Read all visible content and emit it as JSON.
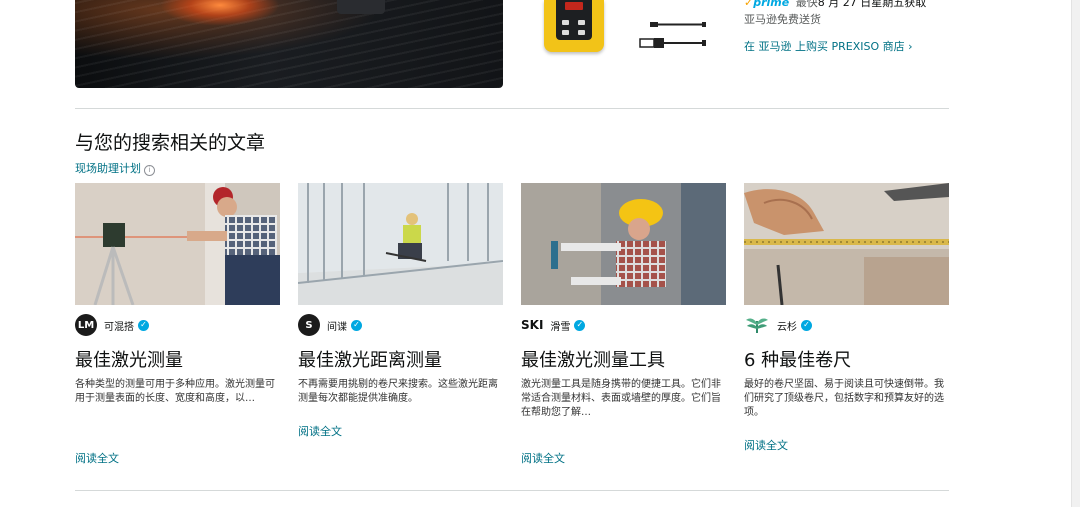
{
  "top_section": {
    "prime_check": "✓",
    "prime_label": "prime",
    "prime_delivery": "最快",
    "prime_date": "8 月 27 日星期五获取",
    "free_shipping": "亚马逊免费送货",
    "store_link": "在 亚马逊 上购买 PREXISO 商店 ›"
  },
  "articles_section": {
    "title": "与您的搜索相关的文章",
    "subtitle_link": "现场助理计划",
    "info_icon": "i"
  },
  "articles": [
    {
      "publisher_logo": "LM",
      "publisher": "可混搭",
      "title": "最佳激光测量",
      "description": "各种类型的测量可用于多种应用。激光测量可用于测量表面的长度、宽度和高度，以…",
      "read_more": "阅读全文",
      "verified": "✓"
    },
    {
      "publisher_logo": "S",
      "publisher": "间谍",
      "title": "最佳激光距离测量",
      "description": "不再需要用挑剔的卷尺来搜索。这些激光距离测量每次都能提供准确度。",
      "read_more": "阅读全文",
      "verified": "✓"
    },
    {
      "publisher_logo": "SKI",
      "publisher": "滑雪",
      "title": "最佳激光测量工具",
      "description": "激光测量工具是随身携带的便捷工具。它们非常适合测量材料、表面或墙壁的厚度。它们旨在帮助您了解…",
      "read_more": "阅读全文",
      "verified": "✓"
    },
    {
      "publisher_logo": "",
      "publisher": "云杉",
      "title": "6 种最佳卷尺",
      "description": "最好的卷尺坚固、易于阅读且可快速倒带。我们研究了顶级卷尺，包括数字和预算友好的选项。",
      "read_more": "阅读全文",
      "verified": "✓"
    }
  ]
}
